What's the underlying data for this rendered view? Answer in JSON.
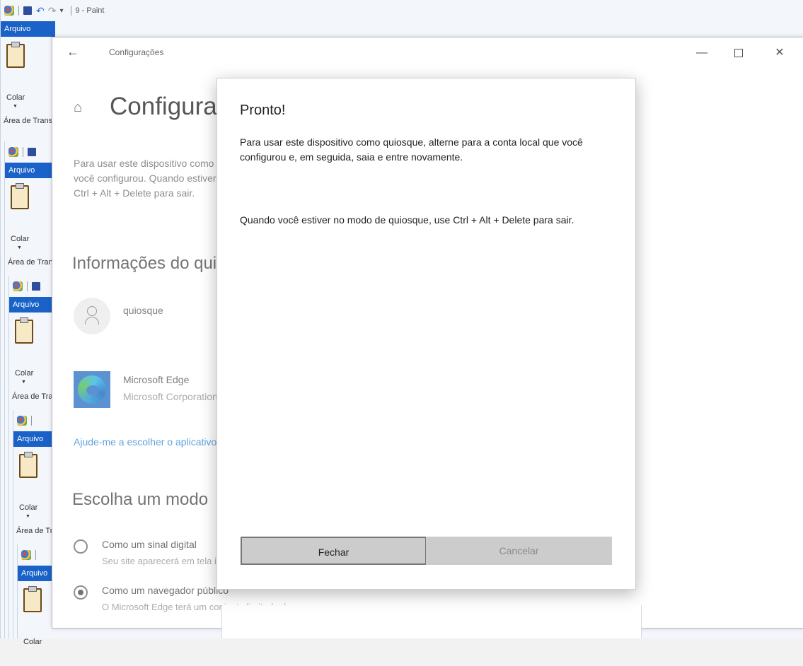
{
  "paint": {
    "title": "9 - Paint",
    "file_tab": "Arquivo",
    "paste_label": "Colar",
    "clipboard_group": "Área de Transferência"
  },
  "settings": {
    "window_title": "Configurações",
    "page_title": "Configurações",
    "description_lines": [
      "Para usar este dispositivo como quiosque, alterne para a conta local que",
      "você configurou. Quando estiver no modo de quiosque, use",
      "Ctrl + Alt + Delete para sair."
    ],
    "kiosk_info_heading": "Informações do quiosque",
    "account_name": "quiosque",
    "app_name": "Microsoft Edge",
    "app_publisher": "Microsoft Corporation",
    "help_link": "Ajude-me a escolher o aplicativo",
    "mode_heading": "Escolha um modo",
    "options": [
      {
        "label": "Como um sinal digital",
        "description": "Seu site aparecerá em tela inteira.",
        "selected": false
      },
      {
        "label": "Como um navegador público",
        "description": "O Microsoft Edge terá um conjunto limitado de recursos.",
        "selected": true
      }
    ]
  },
  "dialog": {
    "title": "Pronto!",
    "body1": "Para usar este dispositivo como quiosque, alterne para a conta local que você configurou e, em seguida, saia e entre novamente.",
    "body2": "Quando você estiver no modo de quiosque, use Ctrl + Alt + Delete para sair.",
    "primary_button": "Fechar",
    "secondary_button": "Cancelar"
  },
  "colors": {
    "paint_tab": "#1a62c8",
    "link": "#3d8fd6",
    "button_bg": "#cccccc"
  }
}
